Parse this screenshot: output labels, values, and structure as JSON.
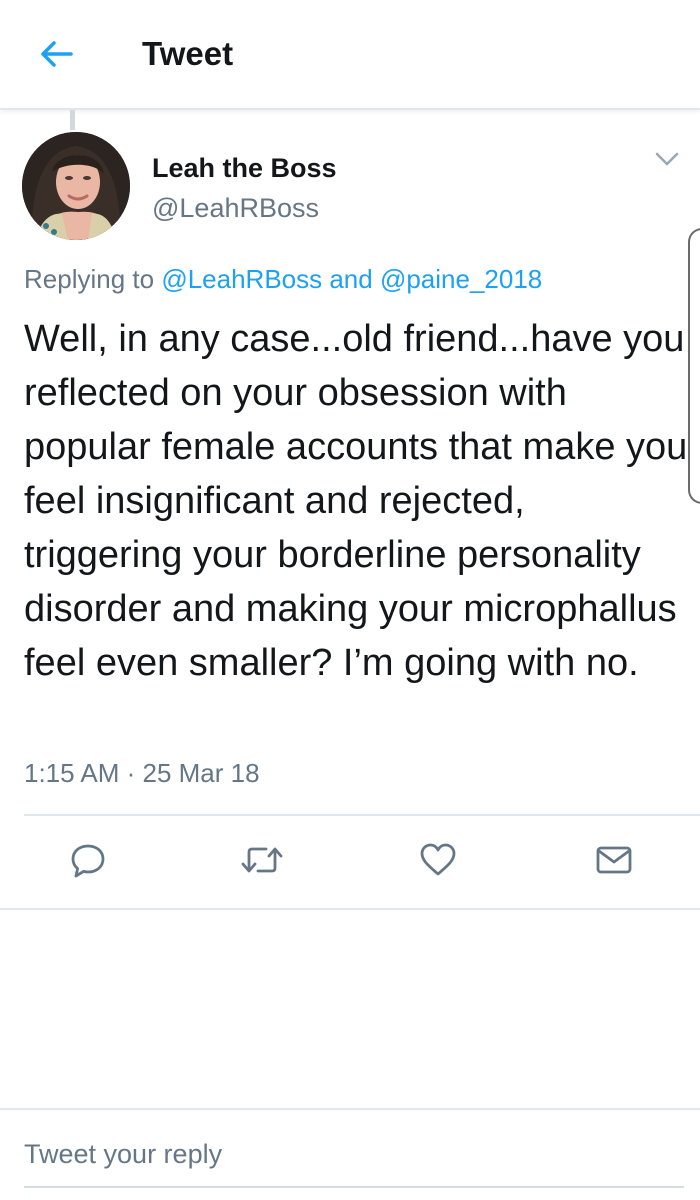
{
  "header": {
    "title": "Tweet",
    "back_icon": "arrow-left-icon"
  },
  "tweet": {
    "author": {
      "display_name": "Leah the Boss",
      "handle": "@LeahRBoss",
      "avatar_icon": "avatar-photo"
    },
    "replying_prefix": "Replying to ",
    "replying_to": [
      "@LeahRBoss",
      "@paine_2018"
    ],
    "replying_joiner": " and ",
    "text": "Well, in any case...old friend...have you reflected on your obsession with popular female accounts that make you feel insignificant and rejected, triggering your borderline personality disorder and making your microphallus feel even smaller? I’m going with no.",
    "timestamp": "1:15 AM · 25 Mar 18"
  },
  "actions": [
    {
      "name": "reply-icon"
    },
    {
      "name": "retweet-icon"
    },
    {
      "name": "like-icon"
    },
    {
      "name": "direct-message-icon"
    }
  ],
  "reply_box": {
    "placeholder": "Tweet your reply"
  },
  "colors": {
    "accent": "#1da1f2",
    "secondary_text": "#657786",
    "primary_text": "#14171a",
    "divider": "#e1e8ed"
  }
}
